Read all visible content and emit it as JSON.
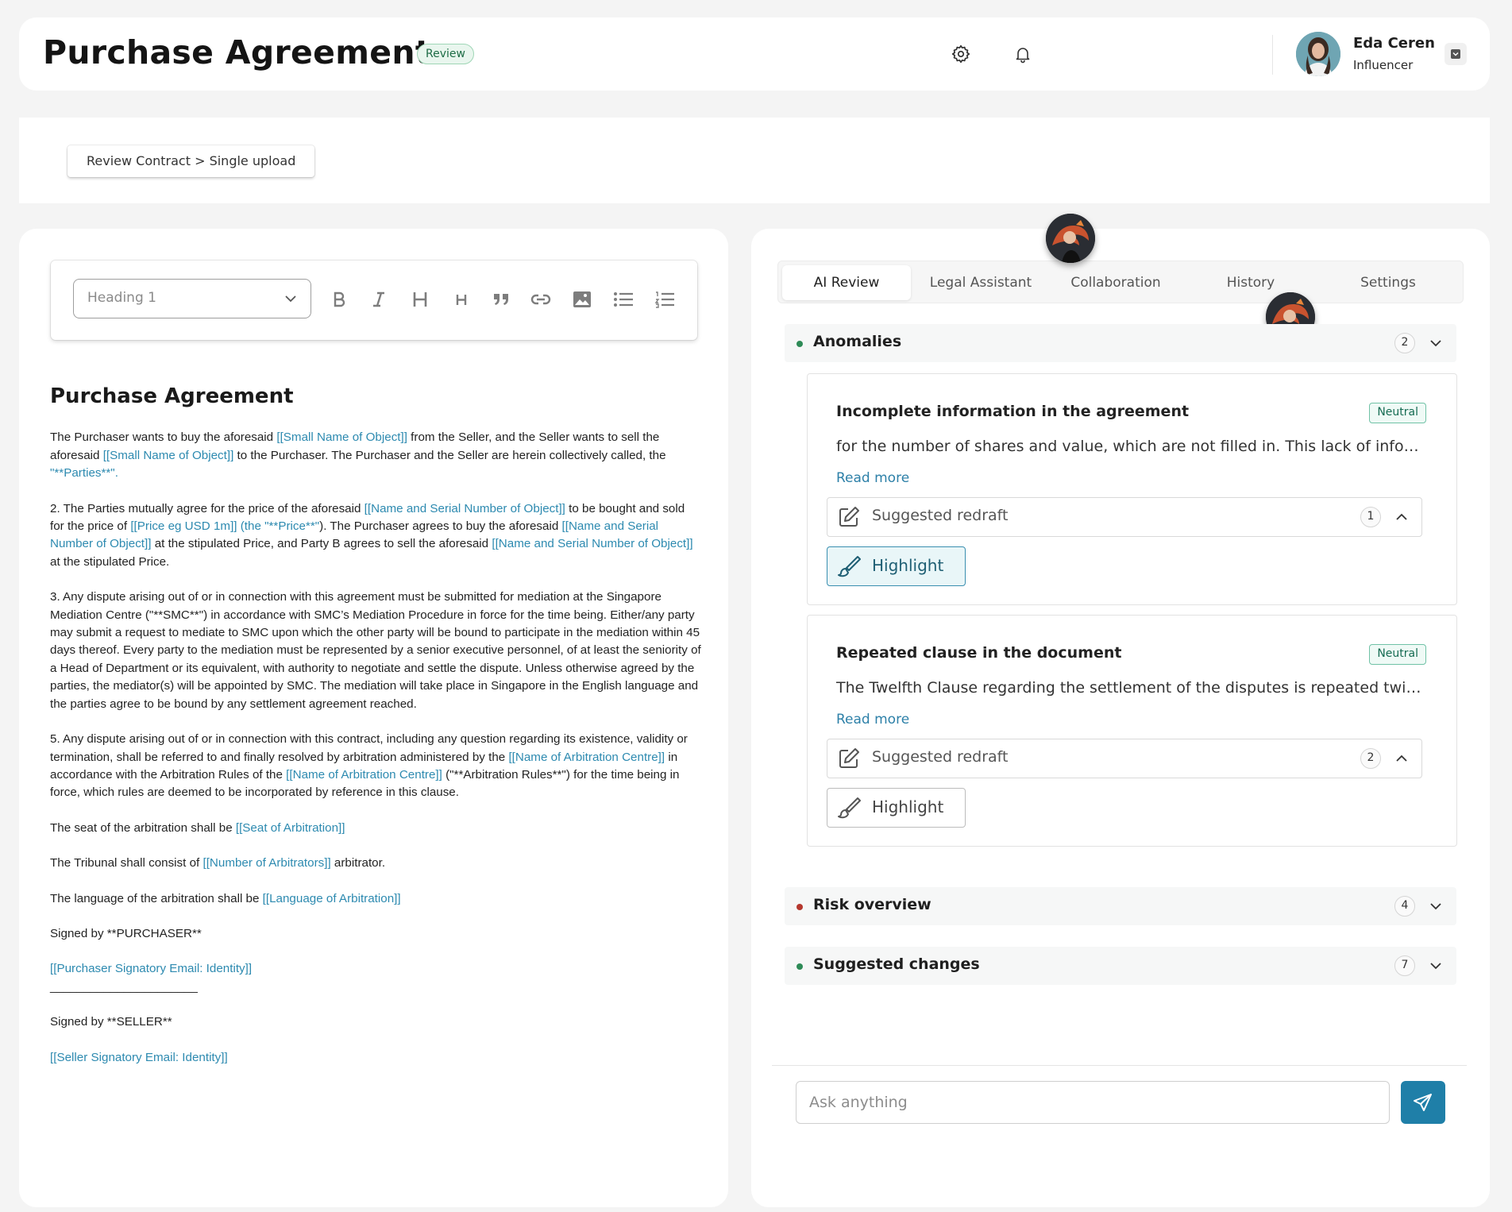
{
  "header": {
    "title": "Purchase Agreement",
    "status": "Review",
    "user": {
      "name": "Eda Ceren",
      "role": "Influencer"
    },
    "icons": [
      "gear-icon",
      "bell-icon",
      "chevron-down-icon"
    ]
  },
  "breadcrumb": "Review Contract > Single upload",
  "toolbar": {
    "heading_select": "Heading 1",
    "buttons": [
      "bold",
      "italic",
      "heading-large",
      "heading-small",
      "quote",
      "link",
      "image",
      "bullet-list",
      "numbered-list"
    ]
  },
  "document": {
    "title": "Purchase Agreement",
    "p1": {
      "a": "The Purchaser wants to buy the aforesaid ",
      "b": "[[Small Name of Object]]",
      "c": " from the Seller, and the Seller wants to sell the aforesaid ",
      "d": "[[Small Name of Object]]",
      "e": " to the Purchaser. The Purchaser and the Seller are herein collectively called, the ",
      "f": "\"**Parties**\"."
    },
    "p2": {
      "a": "2.  The Parties mutually agree for the price of the aforesaid ",
      "b": "[[Name and Serial Number of Object]]",
      "c": " to be bought and sold for the price of ",
      "d": "[[Price eg USD 1m]] (the \"**Price**\"",
      "e": "). The Purchaser agrees to buy the aforesaid ",
      "f": "[[Name and Serial Number of Object]]",
      "g": " at the stipulated Price, and Party B agrees to sell the aforesaid ",
      "h": "[[Name and Serial Number of Object]]",
      "i": " at the stipulated Price."
    },
    "p3": "3.  Any dispute arising out of or in connection with this agreement must be submitted for mediation at the Singapore Mediation Centre (\"**SMC**\") in accordance with SMC’s Mediation Procedure in force for the time being. Either/any party may submit a request to mediate to SMC upon which the other party will be bound to participate in the mediation within 45 days thereof. Every party to the mediation must be represented by a senior executive personnel, of at least the seniority of a Head of Department or its equivalent, with authority to negotiate and settle the dispute. Unless otherwise agreed by the parties, the mediator(s) will be appointed by SMC. The mediation will take place in Singapore in the English language and the parties agree to be bound by any settlement agreement reached.",
    "p5": {
      "a": "5.  Any dispute arising out of or in connection with this contract, including any question regarding its existence, validity or termination, shall be referred to and finally resolved by arbitration administered by the ",
      "b": "[[Name of Arbitration Centre]]",
      "c": " in accordance with the Arbitration Rules of the ",
      "d": "[[Name of Arbitration Centre]]",
      "e": " (\"**Arbitration Rules**\") for the time being in force, which rules are deemed to be incorporated by reference in this clause."
    },
    "seat": {
      "a": "The seat of the arbitration shall be ",
      "b": "[[Seat of Arbitration]]"
    },
    "tribunal": {
      "a": "The Tribunal shall consist of ",
      "b": "[[Number of Arbitrators]]",
      "c": " arbitrator."
    },
    "language": {
      "a": "The language of the arbitration shall be ",
      "b": "[[Language of Arbitration]]"
    },
    "signed_purchaser": "Signed by **PURCHASER**",
    "purchaser_email": "[[Purchaser Signatory Email: Identity]]",
    "separator": "______________________",
    "signed_seller": "Signed by **SELLER**",
    "seller_email": "[[Seller Signatory Email: Identity]]"
  },
  "review": {
    "tabs": [
      "AI Review",
      "Legal Assistant",
      "Collaboration",
      "History",
      "Settings"
    ],
    "active_tab": "AI Review",
    "anomalies": {
      "label": "Anomalies",
      "count": "2",
      "dot_color": "#2e8b57",
      "items": [
        {
          "title": "Incomplete information in the agreement",
          "badge": "Neutral",
          "description": "for the number of shares and value, which are not filled in. This lack of information…",
          "read_more": "Read more",
          "redraft_label": "Suggested redraft",
          "redraft_count": "1",
          "highlight_label": "Highlight",
          "highlight_active": true
        },
        {
          "title": "Repeated clause in the document",
          "badge": "Neutral",
          "description": "The Twelfth Clause regarding the settlement of the disputes is repeated twice…",
          "read_more": "Read more",
          "redraft_label": "Suggested redraft",
          "redraft_count": "2",
          "highlight_label": "Highlight",
          "highlight_active": false
        }
      ]
    },
    "risk": {
      "label": "Risk overview",
      "count": "4",
      "dot_color": "#b5382e"
    },
    "changes": {
      "label": "Suggested changes",
      "count": "7",
      "dot_color": "#2e8b57"
    },
    "chat": {
      "placeholder": "Ask anything"
    }
  },
  "accent_color": "#1f7fa8"
}
